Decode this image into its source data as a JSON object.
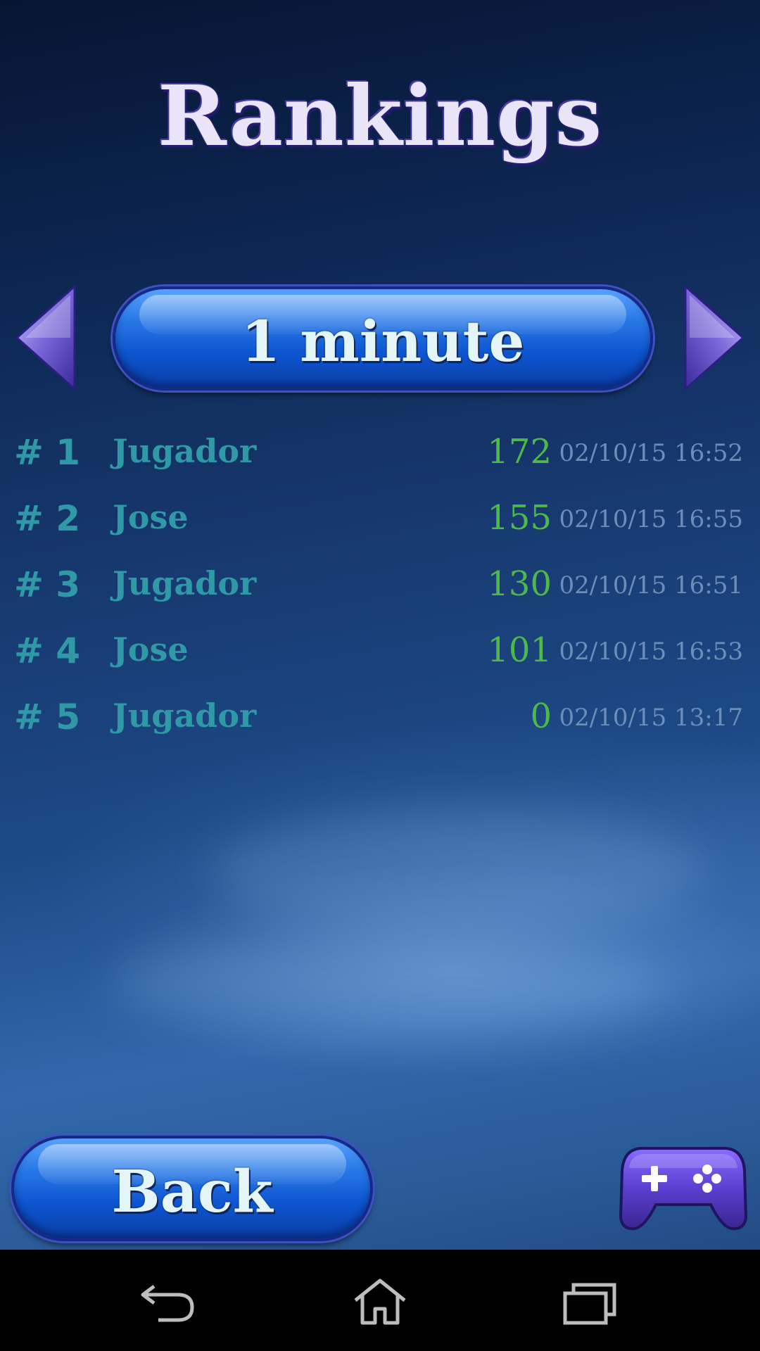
{
  "header": {
    "title": "Rankings"
  },
  "mode_selector": {
    "label": "1 minute"
  },
  "rankings": [
    {
      "position": "# 1",
      "name": "Jugador",
      "score": "172",
      "date": "02/10/15 16:52"
    },
    {
      "position": "# 2",
      "name": "Jose",
      "score": "155",
      "date": "02/10/15 16:55"
    },
    {
      "position": "# 3",
      "name": "Jugador",
      "score": "130",
      "date": "02/10/15 16:51"
    },
    {
      "position": "# 4",
      "name": "Jose",
      "score": "101",
      "date": "02/10/15 16:53"
    },
    {
      "position": "# 5",
      "name": "Jugador",
      "score": "0",
      "date": "02/10/15 13:17"
    }
  ],
  "footer": {
    "back_label": "Back",
    "games_icon": "gamepad-icon"
  },
  "navbar": {
    "icons": [
      "back-arrow-icon",
      "home-icon",
      "recents-icon"
    ]
  },
  "colors": {
    "title": "#e9e4f7",
    "rank_text": "#2f9aa6",
    "score": "#4fb84a",
    "date": "#6b8fb8",
    "button_blue": "#1a6ae0",
    "arrow_purple": "#7a66d8"
  }
}
